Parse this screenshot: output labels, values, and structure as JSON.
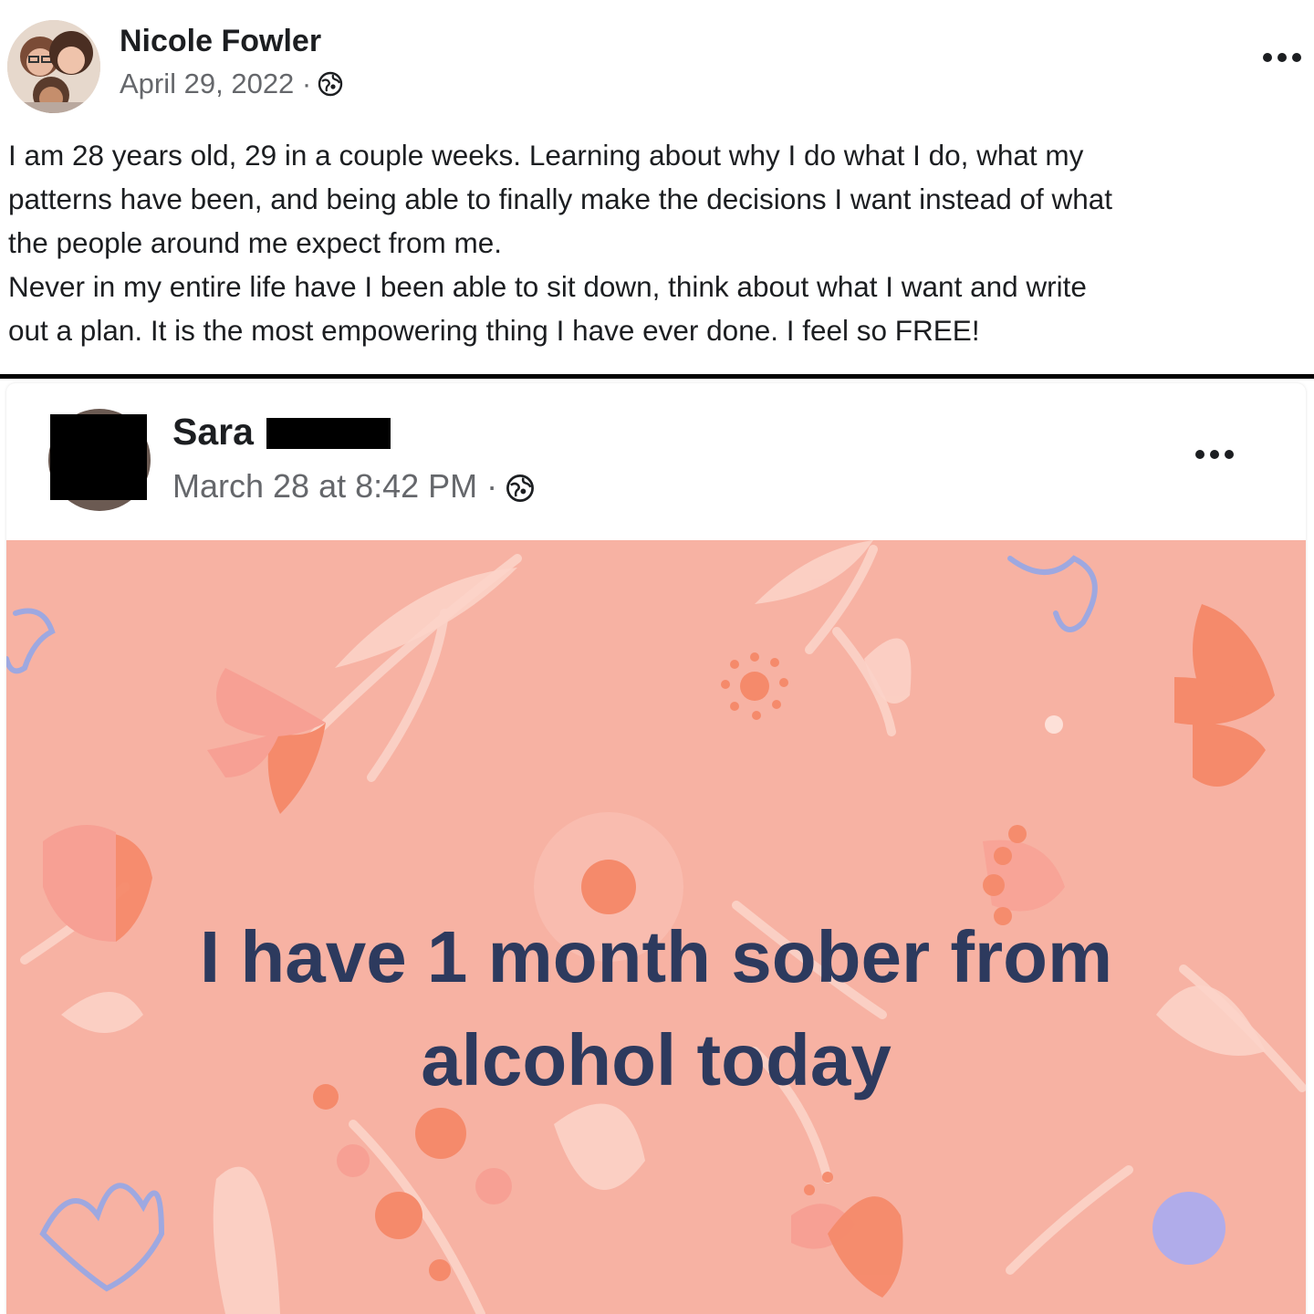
{
  "post": {
    "author": "Nicole Fowler",
    "date": "April 29, 2022 ·",
    "visibility_icon": "globe-icon",
    "more_icon": "more-options-icon",
    "body_lines": [
      "I am 28 years old, 29 in a couple weeks.  Learning about why I do what I do, what my",
      "patterns have been, and being able to finally make the decisions I want instead of what",
      "the people around me expect from me.",
      "Never in my entire life have I been able to sit down, think about what I want and write",
      "out a plan.  It is the most empowering thing I have ever done.  I feel so FREE!"
    ]
  },
  "shared_post": {
    "author": "Sara",
    "date": "March 28 at 8:42 PM ·",
    "visibility_icon": "globe-icon",
    "more_icon": "more-options-icon",
    "card_lines": [
      "I have 1 month sober from",
      "alcohol today"
    ],
    "card_background": "#f7b2a3",
    "card_text_color": "#2d3a5e"
  }
}
